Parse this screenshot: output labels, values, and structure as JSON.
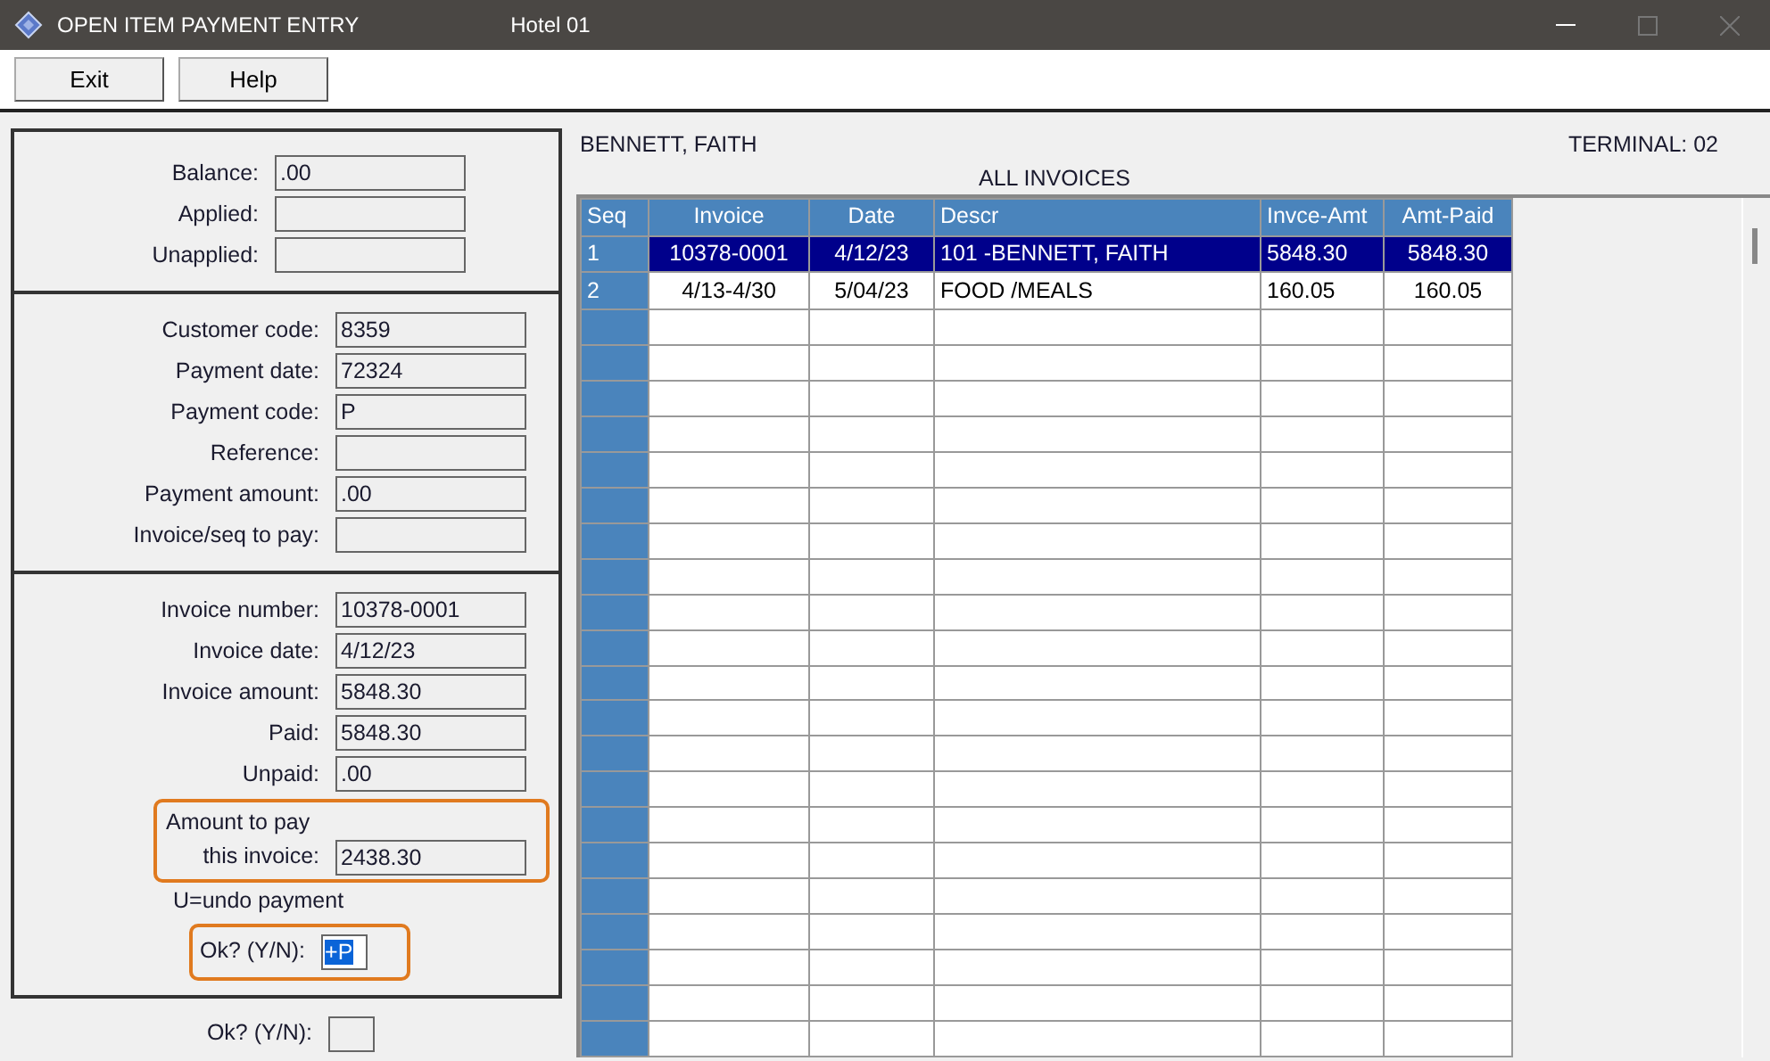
{
  "window": {
    "title": "OPEN ITEM PAYMENT ENTRY",
    "subtitle": "Hotel 01"
  },
  "toolbar": [
    {
      "label": "Exit"
    },
    {
      "label": "Help"
    }
  ],
  "left_panel": {
    "sections": [
      {
        "fields": [
          {
            "kind": "field",
            "label": "Balance:",
            "value": ".00"
          },
          {
            "kind": "field",
            "label": "Applied:"
          },
          {
            "kind": "field",
            "label": "Unapplied:"
          }
        ]
      },
      {
        "fields": [
          {
            "kind": "field",
            "label": "Customer code:",
            "value": "8359"
          },
          {
            "kind": "field",
            "label": "Payment date:",
            "value": "72324"
          },
          {
            "kind": "field",
            "label": "Payment code:",
            "value": "P"
          },
          {
            "kind": "field",
            "label": "Reference:"
          },
          {
            "kind": "field",
            "label": "Payment amount:",
            "value": ".00"
          },
          {
            "kind": "field",
            "label": "Invoice/seq to pay:"
          }
        ]
      },
      {
        "fields": [
          {
            "kind": "field",
            "label": "Invoice number:",
            "value": "10378-0001"
          },
          {
            "kind": "field",
            "label": "Invoice date:",
            "value": "4/12/23"
          },
          {
            "kind": "field",
            "label": "Invoice amount:",
            "value": "5848.30"
          },
          {
            "kind": "field",
            "label": "Paid:",
            "value": "5848.30"
          },
          {
            "kind": "field",
            "label": "Unpaid:",
            "value": ".00"
          },
          {
            "kind": "two_line",
            "caption": "Amount to pay",
            "label": "this invoice:",
            "value": "2438.30",
            "highlighted": true
          },
          {
            "kind": "note",
            "label": "U=undo payment"
          },
          {
            "kind": "small",
            "label": "Ok? (Y/N):",
            "value": "+P",
            "highlighted": true,
            "text_selected": true
          }
        ]
      }
    ]
  },
  "bottom_prompt": {
    "label": "Ok? (Y/N):"
  },
  "customer_name": "BENNETT, FAITH",
  "terminal": "TERMINAL: 02",
  "table": {
    "title": "ALL INVOICES",
    "columns": [
      "Seq",
      "Invoice",
      "Date",
      "Descr",
      "Invce-Amt",
      "Amt-Paid"
    ],
    "rows": [
      {
        "cells": [
          "1",
          "10378-0001",
          "4/12/23",
          "101 -BENNETT, FAITH",
          "5848.30",
          "5848.30"
        ],
        "selected": true
      },
      {
        "cells": [
          "2",
          "4/13-4/30",
          "5/04/23",
          "FOOD /MEALS",
          "160.05",
          "160.05"
        ],
        "selected": false
      }
    ]
  }
}
